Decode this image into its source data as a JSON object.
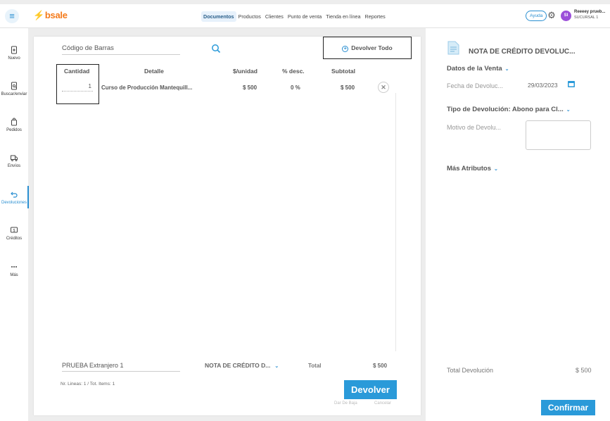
{
  "header": {
    "logo": "bsale",
    "nav": [
      "Documentos",
      "Productos",
      "Clientes",
      "Punto de venta",
      "Tienda en línea",
      "Reportes"
    ],
    "help_label": "Ayuda",
    "avatar_initials": "SI",
    "user_name": "Reeeey prueb...",
    "branch": "SUCURSAL 1"
  },
  "sidebar": {
    "items": [
      {
        "label": "Nuevo",
        "icon": "document-plus-icon"
      },
      {
        "label": "Buscar/enviar",
        "icon": "document-search-icon"
      },
      {
        "label": "Pedidos",
        "icon": "bag-icon"
      },
      {
        "label": "Envíos",
        "icon": "truck-icon"
      },
      {
        "label": "Devoluciones",
        "icon": "return-arrow-icon"
      },
      {
        "label": "Créditos",
        "icon": "credit-icon"
      },
      {
        "label": "Más",
        "icon": "more-dots-icon"
      }
    ],
    "active_index": 4
  },
  "main": {
    "barcode_placeholder": "Código de Barras",
    "return_all_label": "Devolver Todo",
    "columns": [
      "Cantidad",
      "Detalle",
      "$/unidad",
      "% desc.",
      "Subtotal"
    ],
    "rows": [
      {
        "qty": "1",
        "detail": "Curso de Producción Mantequill...",
        "unit": "$ 500",
        "discount": "0 %",
        "subtotal": "$ 500"
      }
    ],
    "client": "PRUEBA Extranjero 1",
    "doc_type": "NOTA DE CRÉDITO D...",
    "total_label": "Total",
    "total_value": "$ 500",
    "lines_info": "Nr. Lineas: 1 / Tot. Items: 1",
    "return_button": "Devolver",
    "write_off_link": "Dar De Baja",
    "cancel_link": "Cancelar"
  },
  "panel": {
    "title": "NOTA DE CRÉDITO DEVOLUC...",
    "sale_data_label": "Datos de la Venta",
    "return_date_label": "Fecha de Devoluc...",
    "return_date_value": "29/03/2023",
    "return_type_label": "Tipo de Devolución: Abono para Cl...",
    "reason_label": "Motivo de Devolu...",
    "more_attrs_label": "Más Atributos",
    "total_return_label": "Total Devolución",
    "total_return_value": "$ 500",
    "confirm_button": "Confirmar"
  },
  "colors": {
    "accent": "#2a9ad9",
    "brand": "#f47a1a",
    "avatar": "#9b4fd9"
  }
}
